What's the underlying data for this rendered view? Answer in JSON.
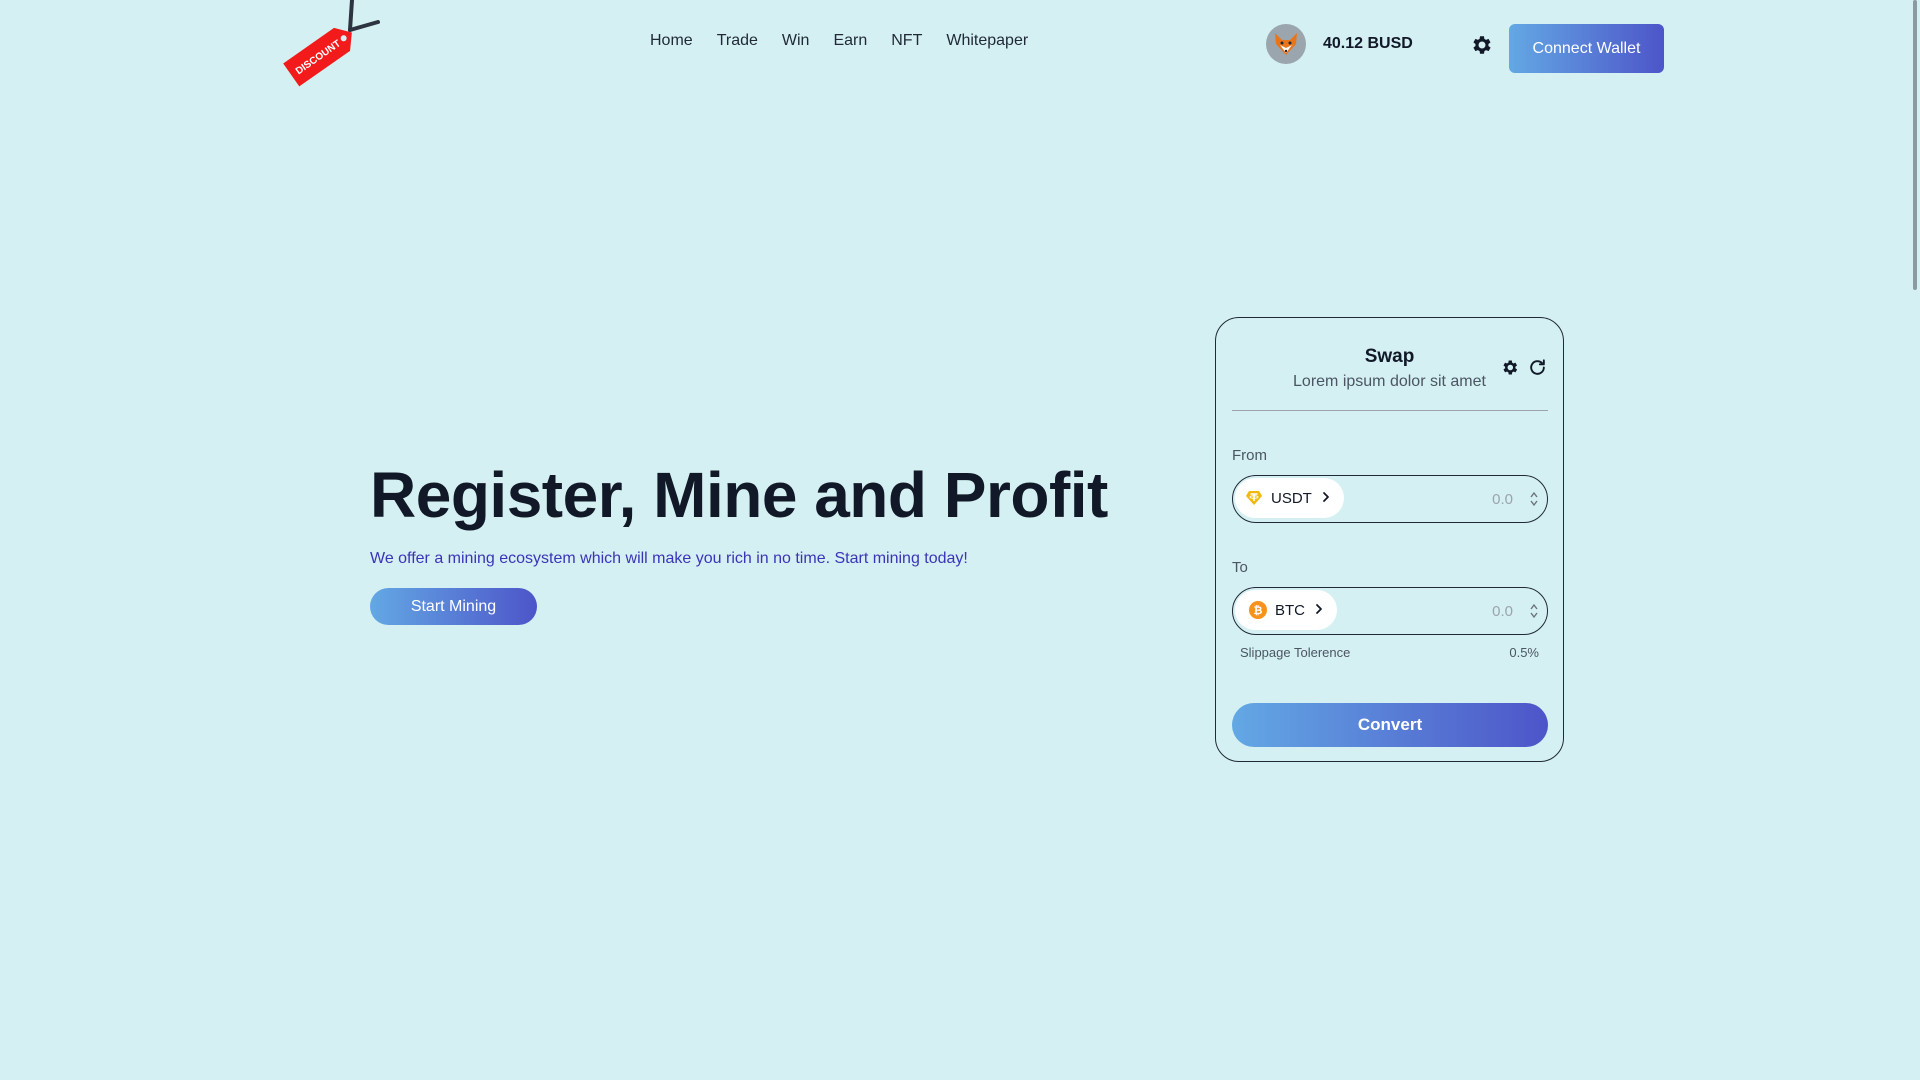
{
  "brand": {
    "tag_label": "DISCOUNT",
    "colors": {
      "background": "#d4f0f2",
      "tag_red": "#f21a1a",
      "gradient_start": "#63a8e4",
      "gradient_end": "#4d55c9",
      "subtitle_blue": "#3b34b8"
    }
  },
  "nav": {
    "items": [
      "Home",
      "Trade",
      "Win",
      "Earn",
      "NFT",
      "Whitepaper"
    ]
  },
  "header": {
    "avatar_icon": "fox-icon",
    "balance": "40.12 BUSD",
    "settings_icon": "gear-icon",
    "connect_label": "Connect Wallet"
  },
  "hero": {
    "title": "Register, Mine and Profit",
    "subtitle": "We offer a mining ecosystem which will make you rich in no time. Start mining today!",
    "cta_label": "Start Mining"
  },
  "swap": {
    "title": "Swap",
    "subtitle": "Lorem ipsum dolor sit amet",
    "from": {
      "label": "From",
      "token": "USDT",
      "token_icon": "tether-icon",
      "placeholder": "0.0"
    },
    "to": {
      "label": "To",
      "token": "BTC",
      "token_icon": "bitcoin-icon",
      "placeholder": "0.0"
    },
    "slippage_label": "Slippage Tolerence",
    "slippage_value": "0.5%",
    "convert_label": "Convert"
  }
}
